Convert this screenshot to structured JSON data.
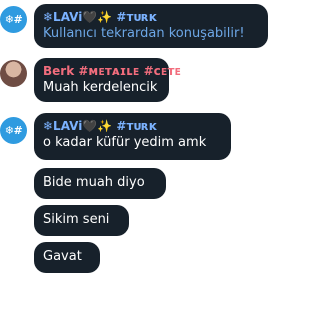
{
  "colors": {
    "bubble_bg": "#17212b",
    "sender_lavi": "#7bb2ff",
    "sender_berk": "#f26d7d",
    "muted_text": "#6da7e6",
    "avatar_hash_bg": "#2f9be0"
  },
  "avatars": {
    "group_glyph": "❄#",
    "icons": [
      "snowflake-hash-avatar",
      "user-photo-avatar"
    ]
  },
  "messages": [
    {
      "sender": "❄LAVi🖤✨ #ᴛᴜʀᴋ",
      "text": "Kullanıcı tekrardan konuşabilir!"
    },
    {
      "sender": "Berk #ᴍᴇᴛᴀɪʟᴇ #ᴄᴇᴛᴇ",
      "text": "Muah kerdelencik"
    },
    {
      "sender": "❄LAVi🖤✨ #ᴛᴜʀᴋ",
      "text": "o kadar küfür yedim amk"
    },
    {
      "text": "Bide muah diyo"
    },
    {
      "text": "Sikim seni"
    },
    {
      "text": "Gavat"
    }
  ]
}
